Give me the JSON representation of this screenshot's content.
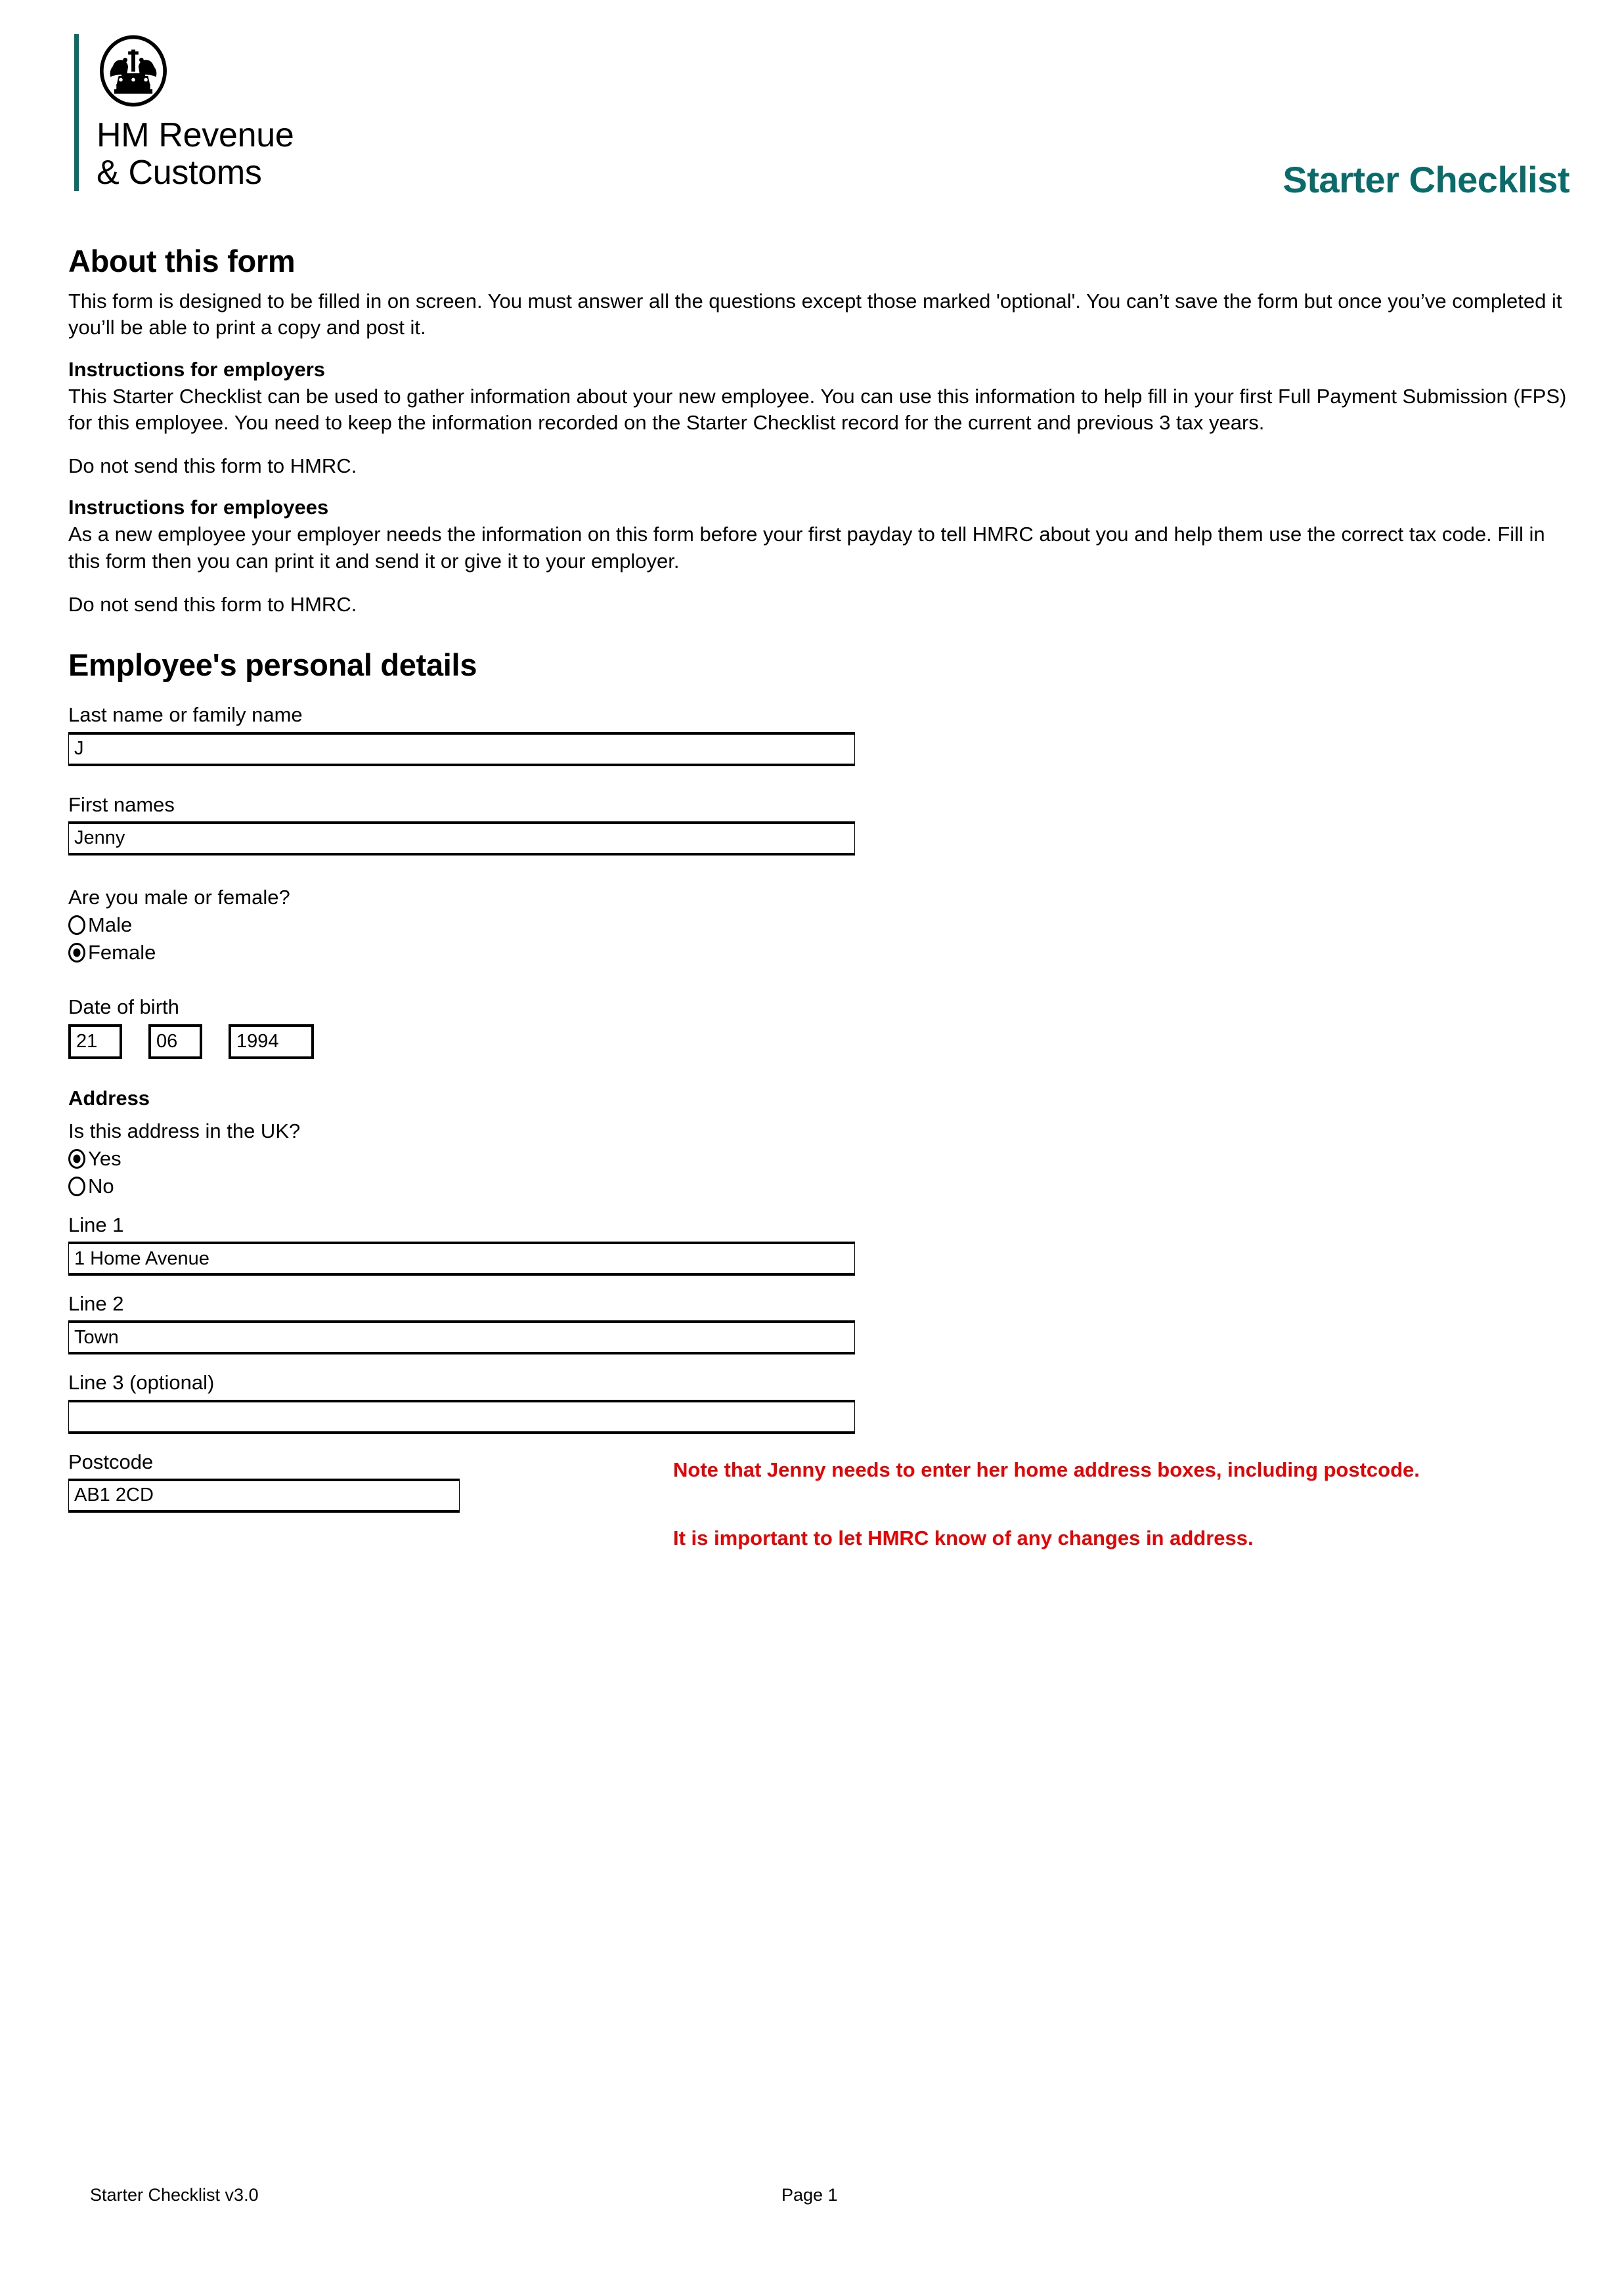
{
  "header": {
    "logo_line1": "HM Revenue",
    "logo_line2": "& Customs",
    "crown_icon": "crown-icon",
    "document_title": "Starter Checklist",
    "accent_color": "#0a6b6b"
  },
  "about": {
    "heading": "About this form",
    "intro": "This form is designed to be filled in on screen. You must answer all the questions except those marked 'optional'. You can’t save the form but once you’ve completed it you’ll be able to print a copy and post it.",
    "employers_heading": "Instructions for employers",
    "employers_text": "This Starter Checklist can be used to gather information about your new employee. You can use this information to help fill in your first Full Payment Submission (FPS) for this employee. You need to keep the information recorded on the Starter Checklist record for the current and previous 3 tax years.",
    "employers_note": "Do not send this form to HMRC.",
    "employees_heading": "Instructions for employees",
    "employees_text": "As a new employee your employer needs the information on this form before your first payday to tell HMRC about you and help them use the correct tax code. Fill in this form then you can print it and send it or give it to your employer.",
    "employees_note": "Do not send this form to HMRC."
  },
  "personal": {
    "heading": "Employee's personal details",
    "last_name_label": "Last name or family name",
    "last_name_value": "J",
    "first_names_label": "First names",
    "first_names_value": "Jenny",
    "gender_question": "Are you male or female?",
    "gender_options": [
      {
        "label": "Male",
        "selected": false
      },
      {
        "label": "Female",
        "selected": true
      }
    ],
    "dob_label": "Date of birth",
    "dob_day": "21",
    "dob_month": "06",
    "dob_year": "1994"
  },
  "address": {
    "heading": "Address",
    "uk_question": "Is this address in the UK?",
    "uk_options": [
      {
        "label": "Yes",
        "selected": true
      },
      {
        "label": "No",
        "selected": false
      }
    ],
    "line1_label": "Line 1",
    "line1_value": "1 Home Avenue",
    "line2_label": "Line 2",
    "line2_value": "Town",
    "line3_label": "Line 3 (optional)",
    "line3_value": "",
    "postcode_label": "Postcode",
    "postcode_value": "AB1 2CD"
  },
  "annotations": {
    "color": "#ee0000",
    "note1": "Note that Jenny needs to enter her home address boxes, including postcode.",
    "note2": "It is important to let HMRC know of any changes in address."
  },
  "footer": {
    "version": "Starter Checklist v3.0",
    "page": "Page 1"
  }
}
